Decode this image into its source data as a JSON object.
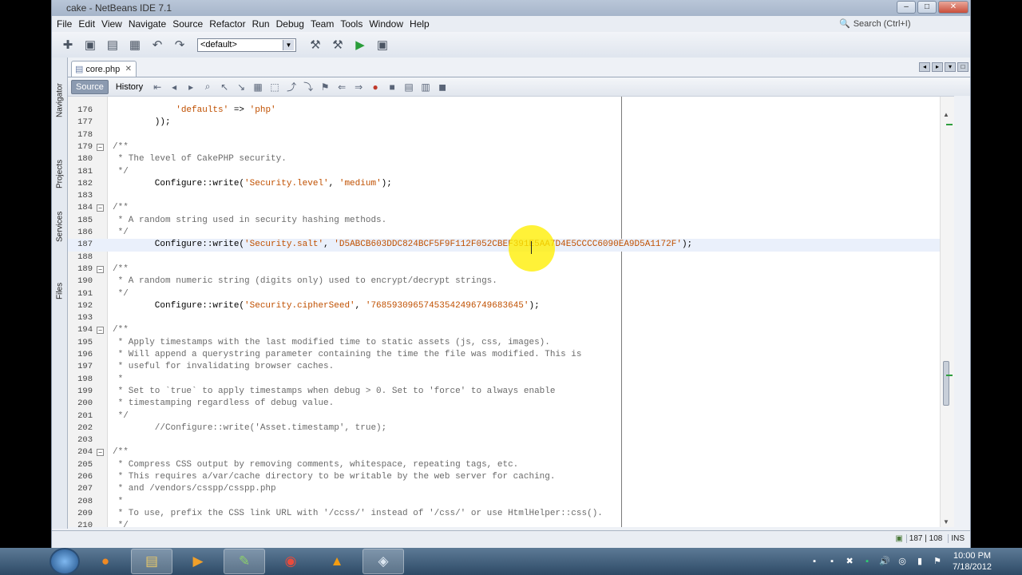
{
  "window": {
    "title": "cake - NetBeans IDE 7.1"
  },
  "menu": [
    "File",
    "Edit",
    "View",
    "Navigate",
    "Source",
    "Refactor",
    "Run",
    "Debug",
    "Team",
    "Tools",
    "Window",
    "Help"
  ],
  "search": {
    "placeholder": "Search (Ctrl+I)"
  },
  "toolbar": {
    "config_value": "<default>"
  },
  "side_tabs": [
    "Navigator",
    "Projects",
    "Services",
    "Files"
  ],
  "editor_tab": {
    "filename": "core.php"
  },
  "editor_toolbar": {
    "source_label": "Source",
    "history_label": "History"
  },
  "code": {
    "lines": [
      {
        "n": "176",
        "text": "            'defaults' => 'php'",
        "kind": "code"
      },
      {
        "n": "177",
        "text": "        ));",
        "kind": "code"
      },
      {
        "n": "178",
        "text": "",
        "kind": "code"
      },
      {
        "n": "179",
        "text": "/**",
        "kind": "comment"
      },
      {
        "n": "180",
        "text": " * The level of CakePHP security.",
        "kind": "comment"
      },
      {
        "n": "181",
        "text": " */",
        "kind": "comment"
      },
      {
        "n": "182",
        "text": "        Configure::write('Security.level', 'medium');",
        "kind": "code"
      },
      {
        "n": "183",
        "text": "",
        "kind": "code"
      },
      {
        "n": "184",
        "text": "/**",
        "kind": "comment"
      },
      {
        "n": "185",
        "text": " * A random string used in security hashing methods.",
        "kind": "comment"
      },
      {
        "n": "186",
        "text": " */",
        "kind": "comment"
      },
      {
        "n": "187",
        "text": "        Configure::write('Security.salt', 'D5ABCB603DDC824BCF5F9F112F052CBEF391E5AA7D4E5CCCC6090EA9D5A1172F');",
        "kind": "code"
      },
      {
        "n": "188",
        "text": "",
        "kind": "code"
      },
      {
        "n": "189",
        "text": "/**",
        "kind": "comment"
      },
      {
        "n": "190",
        "text": " * A random numeric string (digits only) used to encrypt/decrypt strings.",
        "kind": "comment"
      },
      {
        "n": "191",
        "text": " */",
        "kind": "comment"
      },
      {
        "n": "192",
        "text": "        Configure::write('Security.cipherSeed', '76859309657453542496749683645');",
        "kind": "code"
      },
      {
        "n": "193",
        "text": "",
        "kind": "code"
      },
      {
        "n": "194",
        "text": "/**",
        "kind": "comment"
      },
      {
        "n": "195",
        "text": " * Apply timestamps with the last modified time to static assets (js, css, images).",
        "kind": "comment"
      },
      {
        "n": "196",
        "text": " * Will append a querystring parameter containing the time the file was modified. This is",
        "kind": "comment"
      },
      {
        "n": "197",
        "text": " * useful for invalidating browser caches.",
        "kind": "comment"
      },
      {
        "n": "198",
        "text": " *",
        "kind": "comment"
      },
      {
        "n": "199",
        "text": " * Set to `true` to apply timestamps when debug > 0. Set to 'force' to always enable",
        "kind": "comment"
      },
      {
        "n": "200",
        "text": " * timestamping regardless of debug value.",
        "kind": "comment"
      },
      {
        "n": "201",
        "text": " */",
        "kind": "comment"
      },
      {
        "n": "202",
        "text": "        //Configure::write('Asset.timestamp', true);",
        "kind": "comment"
      },
      {
        "n": "203",
        "text": "",
        "kind": "code"
      },
      {
        "n": "204",
        "text": "/**",
        "kind": "comment"
      },
      {
        "n": "205",
        "text": " * Compress CSS output by removing comments, whitespace, repeating tags, etc.",
        "kind": "comment"
      },
      {
        "n": "206",
        "text": " * This requires a/var/cache directory to be writable by the web server for caching.",
        "kind": "comment"
      },
      {
        "n": "207",
        "text": " * and /vendors/csspp/csspp.php",
        "kind": "comment"
      },
      {
        "n": "208",
        "text": " *",
        "kind": "comment"
      },
      {
        "n": "209",
        "text": " * To use, prefix the CSS link URL with '/ccss/' instead of '/css/' or use HtmlHelper::css().",
        "kind": "comment"
      },
      {
        "n": "210",
        "text": " */",
        "kind": "comment"
      }
    ]
  },
  "status": {
    "position": "187 | 108",
    "mode": "INS"
  },
  "taskbar": {
    "time": "10:00 PM",
    "date": "7/18/2012"
  }
}
